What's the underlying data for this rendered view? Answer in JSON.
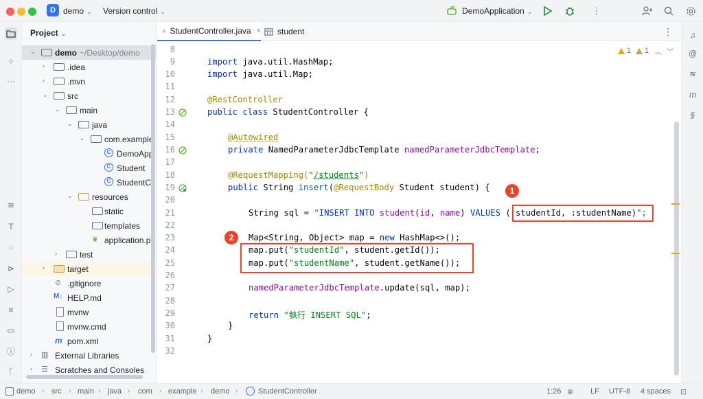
{
  "titlebar": {
    "project_badge": "D",
    "project_name": "demo",
    "version_control": "Version control",
    "run_config": "DemoApplication"
  },
  "project_panel": {
    "title": "Project",
    "tree": [
      {
        "label": "demo",
        "sub": "~/Desktop/demo"
      },
      {
        "label": ".idea"
      },
      {
        "label": ".mvn"
      },
      {
        "label": "src"
      },
      {
        "label": "main"
      },
      {
        "label": "java"
      },
      {
        "label": "com.example"
      },
      {
        "label": "DemoApp"
      },
      {
        "label": "Student"
      },
      {
        "label": "StudentC"
      },
      {
        "label": "resources"
      },
      {
        "label": "static"
      },
      {
        "label": "templates"
      },
      {
        "label": "application.p"
      },
      {
        "label": "test"
      },
      {
        "label": "target"
      },
      {
        "label": ".gitignore"
      },
      {
        "label": "HELP.md"
      },
      {
        "label": "mvnw"
      },
      {
        "label": "mvnw.cmd"
      },
      {
        "label": "pom.xml"
      },
      {
        "label": "External Libraries"
      },
      {
        "label": "Scratches and Consoles"
      }
    ]
  },
  "tabs": [
    {
      "label": "StudentController.java",
      "close": "×"
    },
    {
      "label": "student"
    }
  ],
  "inspections": {
    "warnings_a": "1",
    "warnings_b": "1"
  },
  "code_lines": [
    "8",
    "9",
    "10",
    "11",
    "12",
    "13",
    "14",
    "15",
    "16",
    "17",
    "18",
    "19",
    "20",
    "21",
    "22",
    "23",
    "24",
    "25",
    "26",
    "27",
    "28",
    "29",
    "30",
    "31",
    "32"
  ],
  "code": {
    "l9_kw": "import",
    "l9_rest": " java.util.HashMap;",
    "l10_kw": "import",
    "l10_rest": " java.util.Map;",
    "l12": "@RestController",
    "l13_kw": "public class",
    "l13_rest": " StudentController {",
    "l15": "@Autowired",
    "l16_kw": "private",
    "l16_type": " NamedParameterJdbcTemplate ",
    "l16_field": "namedParameterJdbcTemplate",
    "l16_end": ";",
    "l18_ann": "@RequestMapping(",
    "l18_q1": "\"",
    "l18_path": "/students",
    "l18_q2": "\"",
    "l18_end": ")",
    "l19_kw": "public",
    "l19_a": " String ",
    "l19_m": "insert",
    "l19_b": "(",
    "l19_ann": "@RequestBody",
    "l19_c": " Student student) {",
    "l21_a": "String sql = ",
    "l21_q": "\"",
    "l21_k1": "INSERT INTO",
    "l21_sp1": " ",
    "l21_t": "student",
    "l21_p1": "(",
    "l21_c1": "id",
    "l21_cm": ", ",
    "l21_c2": "name",
    "l21_p2": ") ",
    "l21_k2": "VALUES",
    "l21_sp2": " ",
    "l21_params": "(:studentId, :studentName)",
    "l21_end": "\";",
    "l23_a": "Map<String, Object> map = ",
    "l23_kw": "new",
    "l23_b": " HashMap<>();",
    "l24_a": "map.put(",
    "l24_s": "\"studentId\"",
    "l24_b": ", student.getId());",
    "l25_a": "map.put(",
    "l25_s": "\"studentName\"",
    "l25_b": ", student.getName());",
    "l27_f": "namedParameterJdbcTemplate",
    "l27_b": ".update(sql, map);",
    "l29_kw": "return",
    "l29_sp": " ",
    "l29_s": "\"執行 INSERT SQL\"",
    "l29_end": ";",
    "l30": "}",
    "l31": "}"
  },
  "annotations": {
    "badge1": "1",
    "badge2": "2"
  },
  "statusbar": {
    "breadcrumb": [
      "demo",
      "src",
      "main",
      "java",
      "com",
      "example",
      "demo",
      "StudentController"
    ],
    "position": "1:26",
    "line_sep": "LF",
    "encoding": "UTF-8",
    "indent": "4 spaces"
  }
}
